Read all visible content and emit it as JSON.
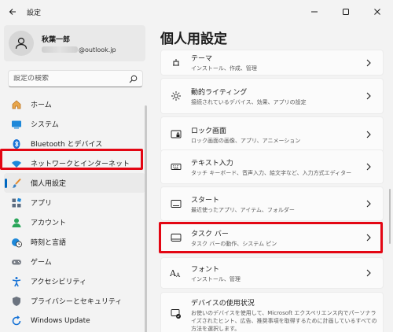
{
  "window": {
    "title": "設定"
  },
  "user": {
    "name": "秋葉一郎",
    "email_suffix": "@outlook.jp"
  },
  "search": {
    "placeholder": "設定の検索"
  },
  "sidebar": {
    "items": [
      {
        "label": "ホーム",
        "icon": "home-icon"
      },
      {
        "label": "システム",
        "icon": "system-icon"
      },
      {
        "label": "Bluetooth とデバイス",
        "icon": "bluetooth-icon"
      },
      {
        "label": "ネットワークとインターネット",
        "icon": "wifi-icon"
      },
      {
        "label": "個人用設定",
        "icon": "brush-icon",
        "active": true
      },
      {
        "label": "アプリ",
        "icon": "apps-icon"
      },
      {
        "label": "アカウント",
        "icon": "account-icon"
      },
      {
        "label": "時刻と言語",
        "icon": "globe-clock-icon"
      },
      {
        "label": "ゲーム",
        "icon": "gamepad-icon"
      },
      {
        "label": "アクセシビリティ",
        "icon": "accessibility-icon"
      },
      {
        "label": "プライバシーとセキュリティ",
        "icon": "shield-icon"
      },
      {
        "label": "Windows Update",
        "icon": "update-icon"
      }
    ]
  },
  "main": {
    "title": "個人用設定",
    "cards": [
      {
        "title": "テーマ",
        "subtitle": "インストール、作成、管理",
        "icon": "theme-icon"
      },
      {
        "title": "動的ライティング",
        "subtitle": "接続されているデバイス、効果、アプリの設定",
        "icon": "dynamic-lighting-icon"
      },
      {
        "title": "ロック画面",
        "subtitle": "ロック画面の画像、アプリ、アニメーション",
        "icon": "lock-screen-icon"
      },
      {
        "title": "テキスト入力",
        "subtitle": "タッチ キーボード、音声入力、絵文字など、入力方式エディター",
        "icon": "keyboard-icon"
      },
      {
        "title": "スタート",
        "subtitle": "最近使ったアプリ、アイテム、フォルダー",
        "icon": "start-icon"
      },
      {
        "title": "タスク バー",
        "subtitle": "タスク バーの動作、システム ピン",
        "icon": "taskbar-icon"
      },
      {
        "title": "フォント",
        "subtitle": "インストール、管理",
        "icon": "font-icon"
      },
      {
        "title": "デバイスの使用状況",
        "subtitle": "お使いのデバイスを使用して、Microsoft エクスペリエンス内でパーソナライズされたヒント、広告、推奨事項を取得するために計画しているすべての方法を選択します。",
        "icon": "device-usage-icon"
      }
    ]
  },
  "colors": {
    "accent": "#0067c0",
    "highlight": "#e30613"
  }
}
